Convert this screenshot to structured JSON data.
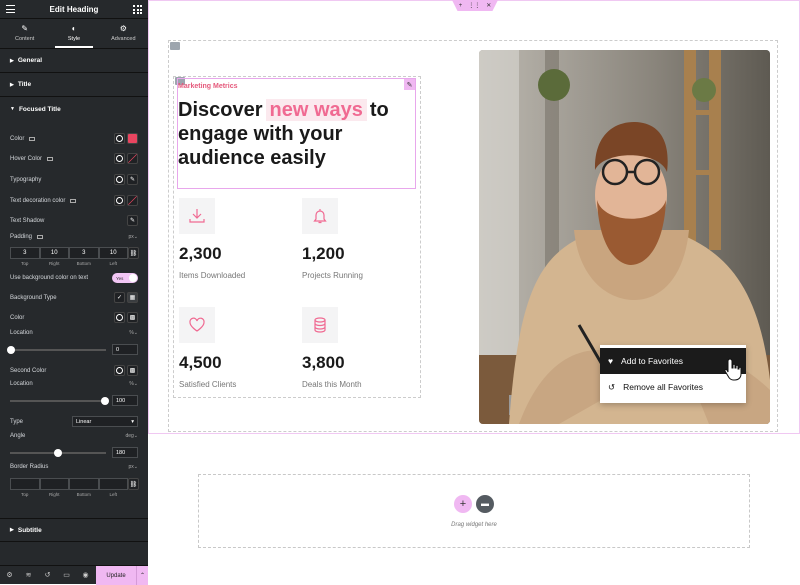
{
  "panel": {
    "title": "Edit Heading",
    "tabs": [
      {
        "label": "Content",
        "icon": "pencil-icon"
      },
      {
        "label": "Style",
        "icon": "contrast-icon"
      },
      {
        "label": "Advanced",
        "icon": "gear-icon"
      }
    ],
    "sections": {
      "general": "General",
      "title": "Title",
      "focused": "Focused Title",
      "subtitle": "Subtitle"
    },
    "controls": {
      "color": "Color",
      "hover_color": "Hover Color",
      "typography": "Typography",
      "text_decoration_color": "Text decoration color",
      "text_shadow": "Text Shadow",
      "padding": "Padding",
      "padding_unit": "px",
      "padding_values": [
        "3",
        "10",
        "3",
        "10"
      ],
      "padding_labels": [
        "Top",
        "Right",
        "Bottom",
        "Left"
      ],
      "use_bg_color": "Use background color on text",
      "use_bg_toggle": "Yes",
      "background_type": "Background Type",
      "bg_color": "Color",
      "location": "Location",
      "location_unit": "%",
      "location_value": "0",
      "second_color": "Second Color",
      "location2": "Location",
      "location2_unit": "%",
      "location2_value": "100",
      "type": "Type",
      "type_value": "Linear",
      "angle": "Angle",
      "angle_unit": "deg",
      "angle_value": "180",
      "border_radius": "Border Radius",
      "border_radius_unit": "px",
      "border_labels": [
        "Top",
        "Right",
        "Bottom",
        "Left"
      ]
    },
    "update": "Update",
    "colors": {
      "accent_swatch": "#e94560",
      "toggle": "#f2c6f5"
    }
  },
  "canvas": {
    "eyebrow": "Marketing Metrics",
    "headline_before": "Discover",
    "headline_highlight": "new ways",
    "headline_after": "to engage with your audience easily",
    "stats": [
      {
        "value": "2,300",
        "label": "Items Downloaded",
        "icon": "download-icon"
      },
      {
        "value": "1,200",
        "label": "Projects Running",
        "icon": "bell-icon"
      },
      {
        "value": "4,500",
        "label": "Satisfied Clients",
        "icon": "heart-icon"
      },
      {
        "value": "3,800",
        "label": "Deals this Month",
        "icon": "database-icon"
      }
    ],
    "context_menu": {
      "add": "Add to Favorites",
      "remove": "Remove all Favorites"
    },
    "drop_text": "Drag widget here",
    "accent": "#f06a92"
  }
}
